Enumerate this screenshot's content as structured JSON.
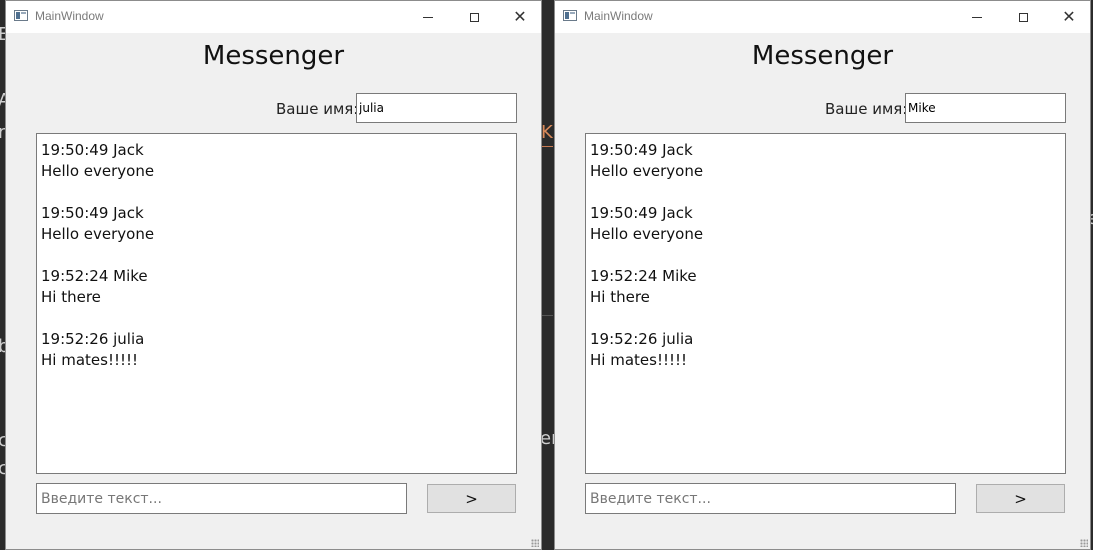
{
  "background": {
    "fragments": [
      "E",
      "A",
      "r",
      "b",
      "c",
      "c",
      "K",
      "er",
      "e"
    ]
  },
  "windows": [
    {
      "title": "MainWindow",
      "heading": "Messenger",
      "name_label": "Ваше имя:",
      "name_value": "julia",
      "messages": [
        {
          "header": "19:50:49 Jack",
          "text": "Hello everyone"
        },
        {
          "header": "19:50:49 Jack",
          "text": "Hello everyone"
        },
        {
          "header": "19:52:24 Mike",
          "text": "Hi there"
        },
        {
          "header": "19:52:26 julia",
          "text": "Hi mates!!!!!"
        }
      ],
      "input_placeholder": "Введите текст...",
      "send_label": ">"
    },
    {
      "title": "MainWindow",
      "heading": "Messenger",
      "name_label": "Ваше имя:",
      "name_value": "Mike",
      "messages": [
        {
          "header": "19:50:49 Jack",
          "text": "Hello everyone"
        },
        {
          "header": "19:50:49 Jack",
          "text": "Hello everyone"
        },
        {
          "header": "19:52:24 Mike",
          "text": "Hi there"
        },
        {
          "header": "19:52:26 julia",
          "text": "Hi mates!!!!!"
        }
      ],
      "input_placeholder": "Введите текст...",
      "send_label": ">"
    }
  ]
}
